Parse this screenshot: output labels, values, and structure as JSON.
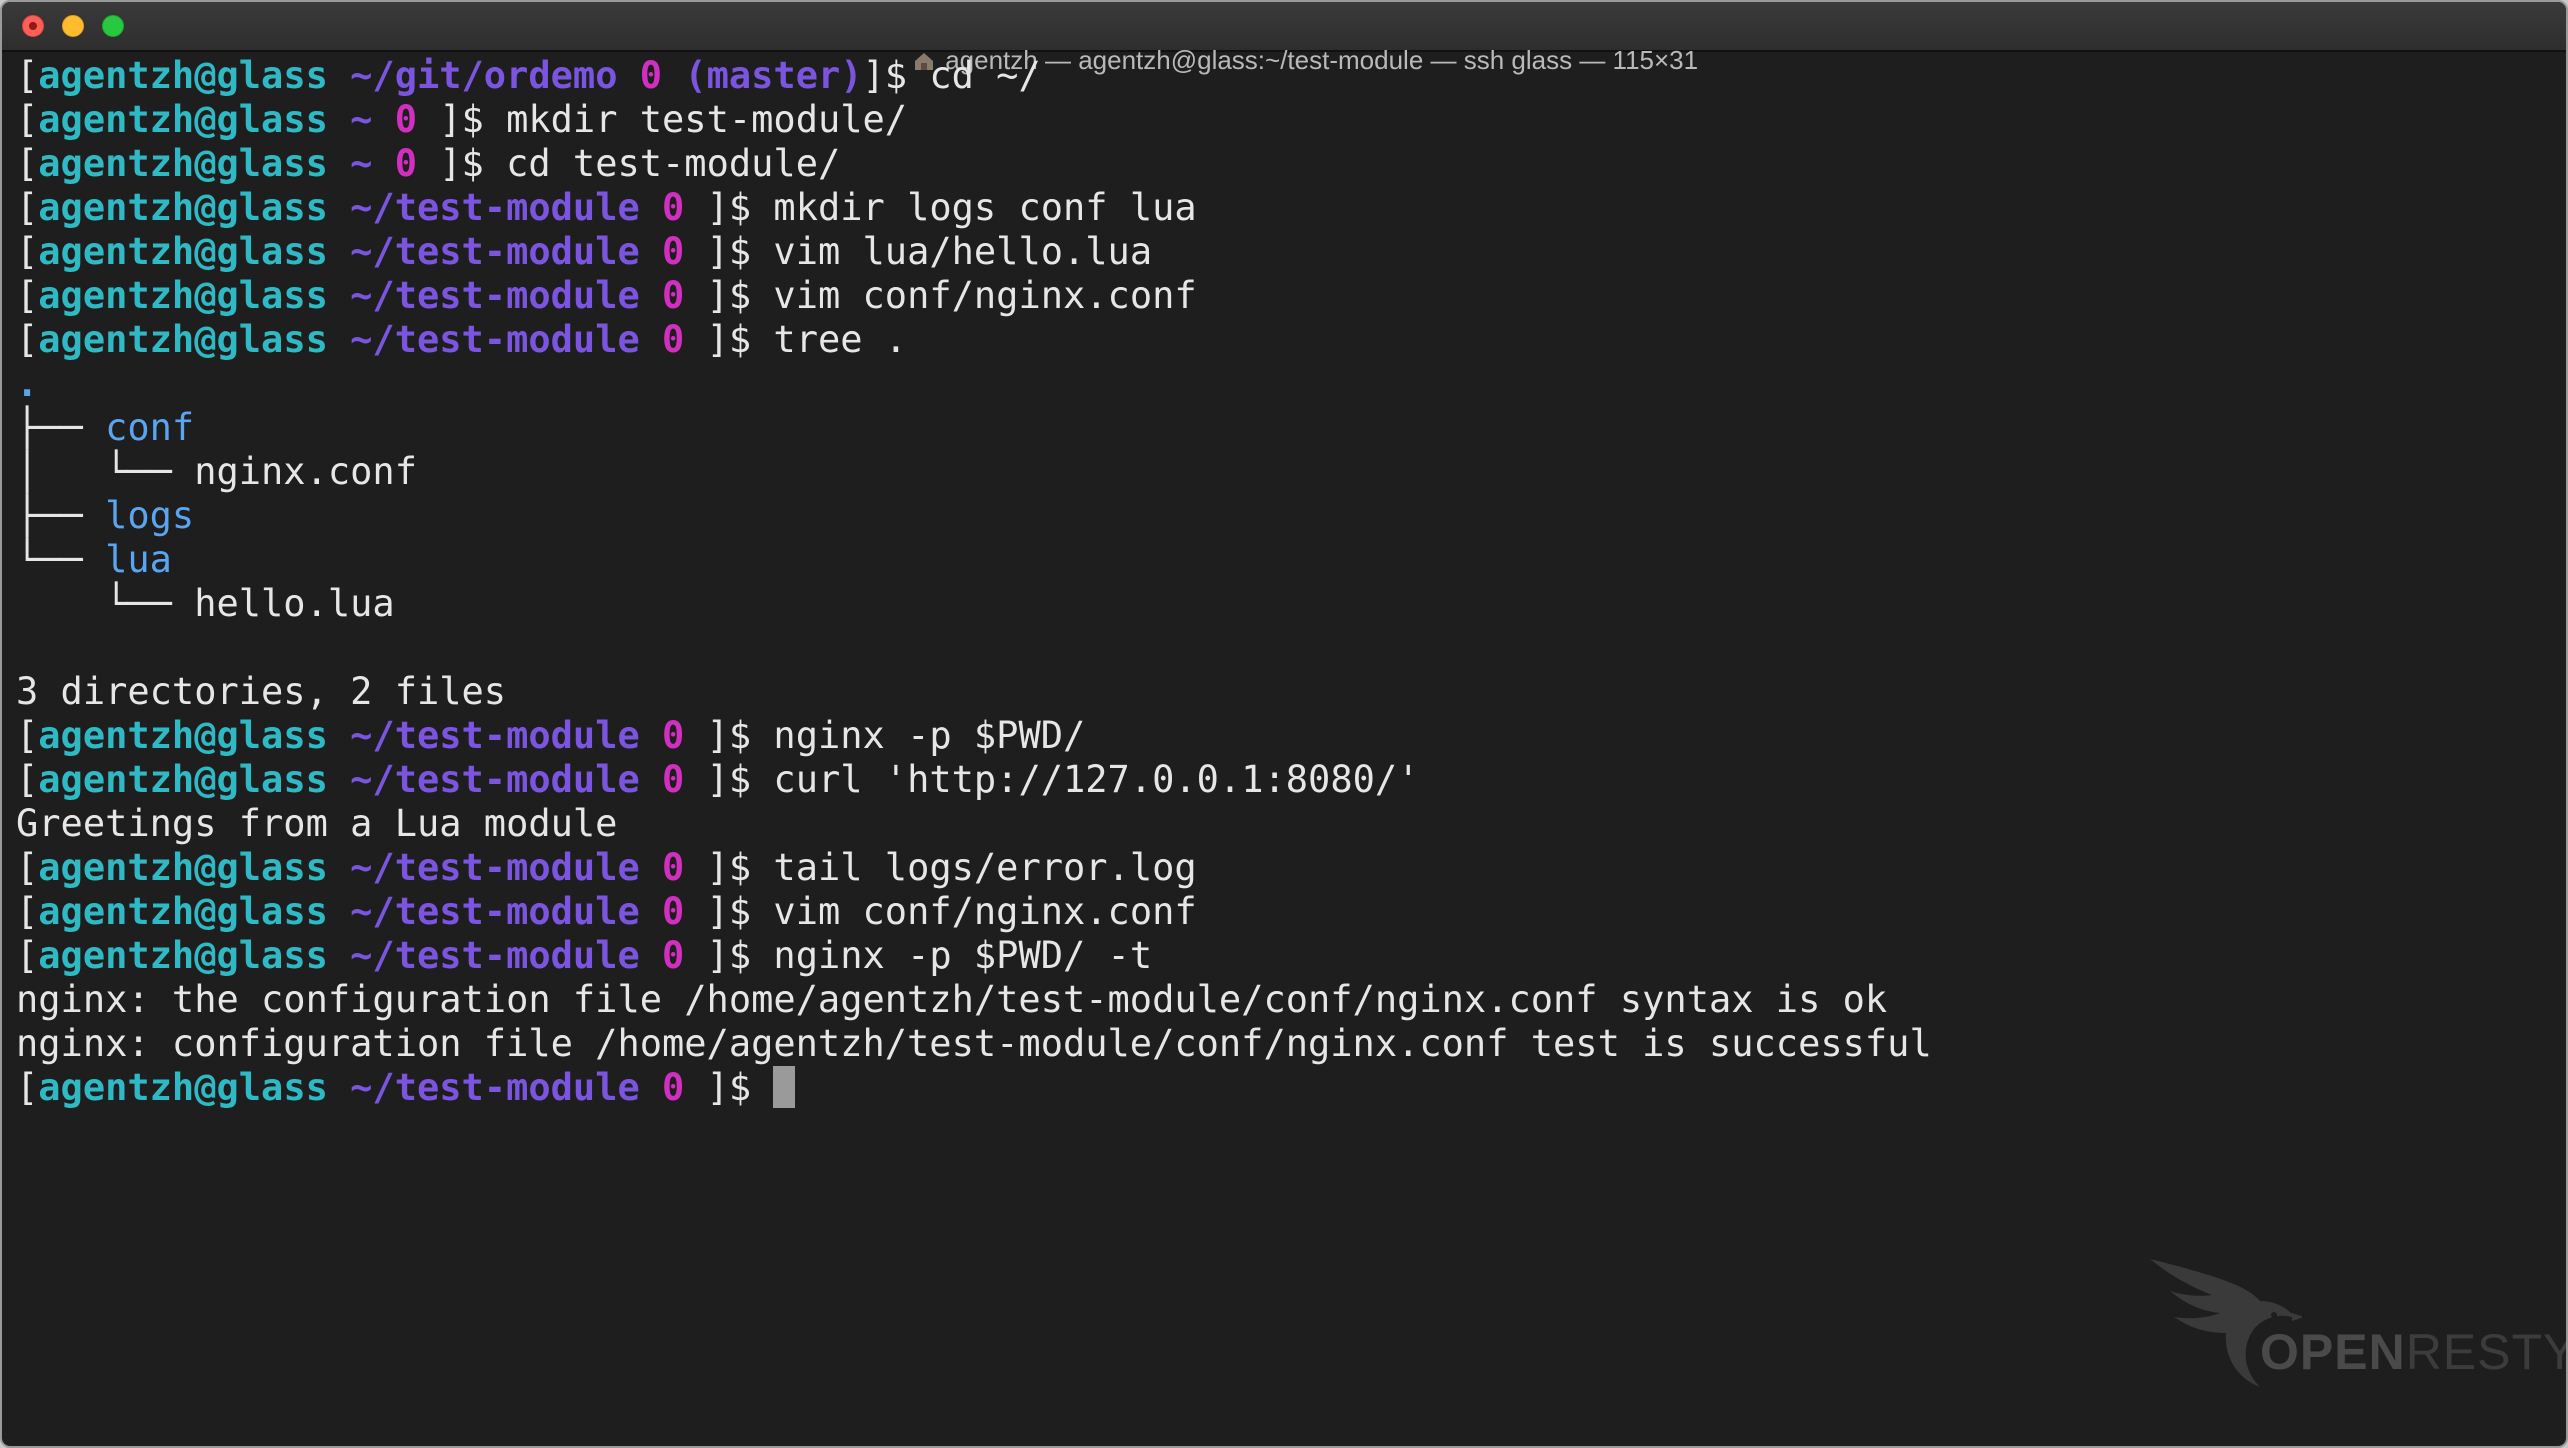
{
  "window": {
    "title": "agentzh — agentzh@glass:~/test-module — ssh glass — 115×31"
  },
  "colors": {
    "background": "#1e1e1e",
    "text": "#e6e6e6",
    "user_host": "#2fb9c4",
    "path": "#7b55e0",
    "status": "#d12fc0",
    "directory": "#5aa5f0"
  },
  "terminal": {
    "lines": [
      {
        "segs": [
          {
            "t": "[",
            "c": "tx"
          },
          {
            "t": "agentzh@glass",
            "c": "uh"
          },
          {
            "t": " ",
            "c": "tx"
          },
          {
            "t": "~/git/ordemo",
            "c": "pth"
          },
          {
            "t": " ",
            "c": "tx"
          },
          {
            "t": "0",
            "c": "sts"
          },
          {
            "t": " ",
            "c": "tx"
          },
          {
            "t": "(master)",
            "c": "brn"
          },
          {
            "t": "]$ cd ~/",
            "c": "tx"
          }
        ]
      },
      {
        "segs": [
          {
            "t": "[",
            "c": "tx"
          },
          {
            "t": "agentzh@glass",
            "c": "uh"
          },
          {
            "t": " ",
            "c": "tx"
          },
          {
            "t": "~",
            "c": "pth"
          },
          {
            "t": " ",
            "c": "tx"
          },
          {
            "t": "0",
            "c": "sts"
          },
          {
            "t": " ]$ mkdir test-module/",
            "c": "tx"
          }
        ]
      },
      {
        "segs": [
          {
            "t": "[",
            "c": "tx"
          },
          {
            "t": "agentzh@glass",
            "c": "uh"
          },
          {
            "t": " ",
            "c": "tx"
          },
          {
            "t": "~",
            "c": "pth"
          },
          {
            "t": " ",
            "c": "tx"
          },
          {
            "t": "0",
            "c": "sts"
          },
          {
            "t": " ]$ cd test-module/",
            "c": "tx"
          }
        ]
      },
      {
        "segs": [
          {
            "t": "[",
            "c": "tx"
          },
          {
            "t": "agentzh@glass",
            "c": "uh"
          },
          {
            "t": " ",
            "c": "tx"
          },
          {
            "t": "~/test-module",
            "c": "pth"
          },
          {
            "t": " ",
            "c": "tx"
          },
          {
            "t": "0",
            "c": "sts"
          },
          {
            "t": " ]$ mkdir logs conf lua",
            "c": "tx"
          }
        ]
      },
      {
        "segs": [
          {
            "t": "[",
            "c": "tx"
          },
          {
            "t": "agentzh@glass",
            "c": "uh"
          },
          {
            "t": " ",
            "c": "tx"
          },
          {
            "t": "~/test-module",
            "c": "pth"
          },
          {
            "t": " ",
            "c": "tx"
          },
          {
            "t": "0",
            "c": "sts"
          },
          {
            "t": " ]$ vim lua/hello.lua",
            "c": "tx"
          }
        ]
      },
      {
        "segs": [
          {
            "t": "[",
            "c": "tx"
          },
          {
            "t": "agentzh@glass",
            "c": "uh"
          },
          {
            "t": " ",
            "c": "tx"
          },
          {
            "t": "~/test-module",
            "c": "pth"
          },
          {
            "t": " ",
            "c": "tx"
          },
          {
            "t": "0",
            "c": "sts"
          },
          {
            "t": " ]$ vim conf/nginx.conf",
            "c": "tx"
          }
        ]
      },
      {
        "segs": [
          {
            "t": "[",
            "c": "tx"
          },
          {
            "t": "agentzh@glass",
            "c": "uh"
          },
          {
            "t": " ",
            "c": "tx"
          },
          {
            "t": "~/test-module",
            "c": "pth"
          },
          {
            "t": " ",
            "c": "tx"
          },
          {
            "t": "0",
            "c": "sts"
          },
          {
            "t": " ]$ tree .",
            "c": "tx"
          }
        ]
      },
      {
        "segs": [
          {
            "t": ".",
            "c": "dot"
          }
        ]
      },
      {
        "segs": [
          {
            "t": "├── ",
            "c": "tx"
          },
          {
            "t": "conf",
            "c": "dir"
          }
        ]
      },
      {
        "segs": [
          {
            "t": "│   └── nginx.conf",
            "c": "tx"
          }
        ]
      },
      {
        "segs": [
          {
            "t": "├── ",
            "c": "tx"
          },
          {
            "t": "logs",
            "c": "dir"
          }
        ]
      },
      {
        "segs": [
          {
            "t": "└── ",
            "c": "tx"
          },
          {
            "t": "lua",
            "c": "dir"
          }
        ]
      },
      {
        "segs": [
          {
            "t": "    └── hello.lua",
            "c": "tx"
          }
        ]
      },
      {
        "segs": []
      },
      {
        "segs": [
          {
            "t": "3 directories, 2 files",
            "c": "tx"
          }
        ]
      },
      {
        "segs": [
          {
            "t": "[",
            "c": "tx"
          },
          {
            "t": "agentzh@glass",
            "c": "uh"
          },
          {
            "t": " ",
            "c": "tx"
          },
          {
            "t": "~/test-module",
            "c": "pth"
          },
          {
            "t": " ",
            "c": "tx"
          },
          {
            "t": "0",
            "c": "sts"
          },
          {
            "t": " ]$ nginx -p $PWD/",
            "c": "tx"
          }
        ]
      },
      {
        "segs": [
          {
            "t": "[",
            "c": "tx"
          },
          {
            "t": "agentzh@glass",
            "c": "uh"
          },
          {
            "t": " ",
            "c": "tx"
          },
          {
            "t": "~/test-module",
            "c": "pth"
          },
          {
            "t": " ",
            "c": "tx"
          },
          {
            "t": "0",
            "c": "sts"
          },
          {
            "t": " ]$ curl 'http://127.0.0.1:8080/'",
            "c": "tx"
          }
        ]
      },
      {
        "segs": [
          {
            "t": "Greetings from a Lua module",
            "c": "tx"
          }
        ]
      },
      {
        "segs": [
          {
            "t": "[",
            "c": "tx"
          },
          {
            "t": "agentzh@glass",
            "c": "uh"
          },
          {
            "t": " ",
            "c": "tx"
          },
          {
            "t": "~/test-module",
            "c": "pth"
          },
          {
            "t": " ",
            "c": "tx"
          },
          {
            "t": "0",
            "c": "sts"
          },
          {
            "t": " ]$ tail logs/error.log",
            "c": "tx"
          }
        ]
      },
      {
        "segs": [
          {
            "t": "[",
            "c": "tx"
          },
          {
            "t": "agentzh@glass",
            "c": "uh"
          },
          {
            "t": " ",
            "c": "tx"
          },
          {
            "t": "~/test-module",
            "c": "pth"
          },
          {
            "t": " ",
            "c": "tx"
          },
          {
            "t": "0",
            "c": "sts"
          },
          {
            "t": " ]$ vim conf/nginx.conf",
            "c": "tx"
          }
        ]
      },
      {
        "segs": [
          {
            "t": "[",
            "c": "tx"
          },
          {
            "t": "agentzh@glass",
            "c": "uh"
          },
          {
            "t": " ",
            "c": "tx"
          },
          {
            "t": "~/test-module",
            "c": "pth"
          },
          {
            "t": " ",
            "c": "tx"
          },
          {
            "t": "0",
            "c": "sts"
          },
          {
            "t": " ]$ nginx -p $PWD/ -t",
            "c": "tx"
          }
        ]
      },
      {
        "segs": [
          {
            "t": "nginx: the configuration file /home/agentzh/test-module/conf/nginx.conf syntax is ok",
            "c": "tx"
          }
        ]
      },
      {
        "segs": [
          {
            "t": "nginx: configuration file /home/agentzh/test-module/conf/nginx.conf test is successful",
            "c": "tx"
          }
        ]
      },
      {
        "segs": [
          {
            "t": "[",
            "c": "tx"
          },
          {
            "t": "agentzh@glass",
            "c": "uh"
          },
          {
            "t": " ",
            "c": "tx"
          },
          {
            "t": "~/test-module",
            "c": "pth"
          },
          {
            "t": " ",
            "c": "tx"
          },
          {
            "t": "0",
            "c": "sts"
          },
          {
            "t": " ]$ ",
            "c": "tx"
          }
        ],
        "cursor": true
      }
    ]
  },
  "watermark": {
    "bold": "OPEN",
    "light": "RESTY"
  }
}
